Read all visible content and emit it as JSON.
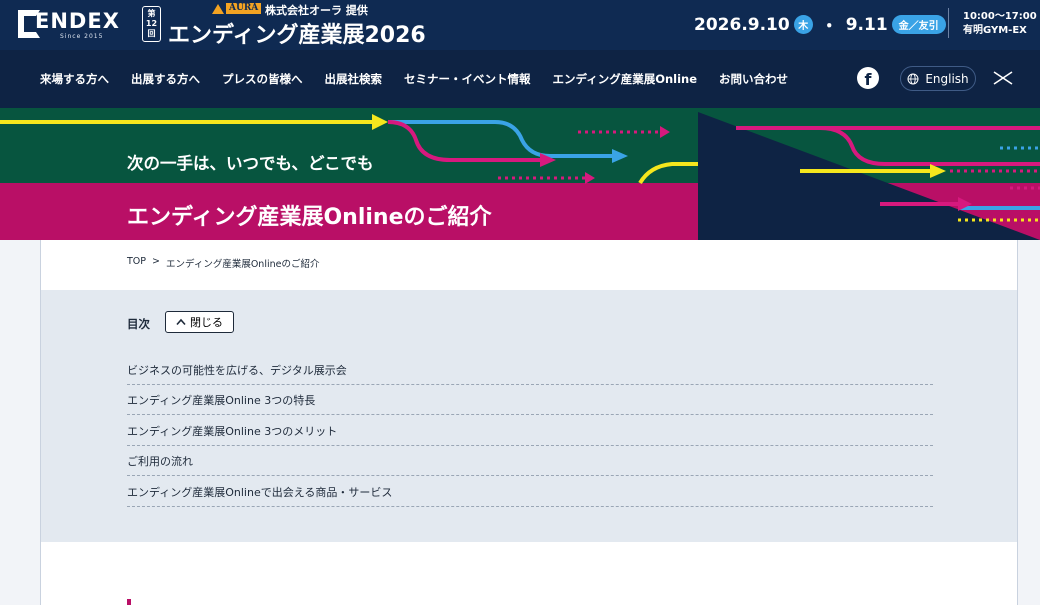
{
  "header": {
    "logo_text": "ENDEX",
    "logo_since": "Since 2015",
    "edition": [
      "第",
      "12",
      "回"
    ],
    "sponsor_logo": "AURA",
    "sponsor_text": "株式会社オーラ 提供",
    "expo_title": "エンディング産業展2026",
    "date_start": "2026.9.10",
    "day_start": "木",
    "date_sep": "・",
    "date_end": "9.11",
    "day_end": "金／友引",
    "time": "10:00〜17:00",
    "venue": "有明GYM-EX"
  },
  "nav": {
    "items": [
      "来場する方へ",
      "出展する方へ",
      "プレスの皆様へ",
      "出展社検索",
      "セミナー・イベント情報",
      "エンディング産業展Online",
      "お問い合わせ"
    ],
    "language_label": "English",
    "facebook_icon": "facebook-icon",
    "menu_close_icon": "close-icon"
  },
  "hero": {
    "tagline": "次の一手は、いつでも、どこでも",
    "heading": "エンディング産業展Onlineのご紹介"
  },
  "breadcrumb": {
    "home": "TOP",
    "separator": ">",
    "current": "エンディング産業展Onlineのご紹介"
  },
  "toc": {
    "title": "目次",
    "close_label": "閉じる",
    "items": [
      "ビジネスの可能性を広げる、デジタル展示会",
      "エンディング産業展Online 3つの特長",
      "エンディング産業展Online 3つのメリット",
      "ご利用の流れ",
      "エンディング産業展Onlineで出会える商品・サービス"
    ]
  },
  "colors": {
    "header_bg": "#0f2a52",
    "nav_bg": "#0e2344",
    "hero_green": "#07553f",
    "hero_magenta": "#b90f66",
    "accent_blue": "#3aa3e6",
    "accent_yellow": "#f5e61d",
    "toc_bg": "#e3e9f0"
  }
}
